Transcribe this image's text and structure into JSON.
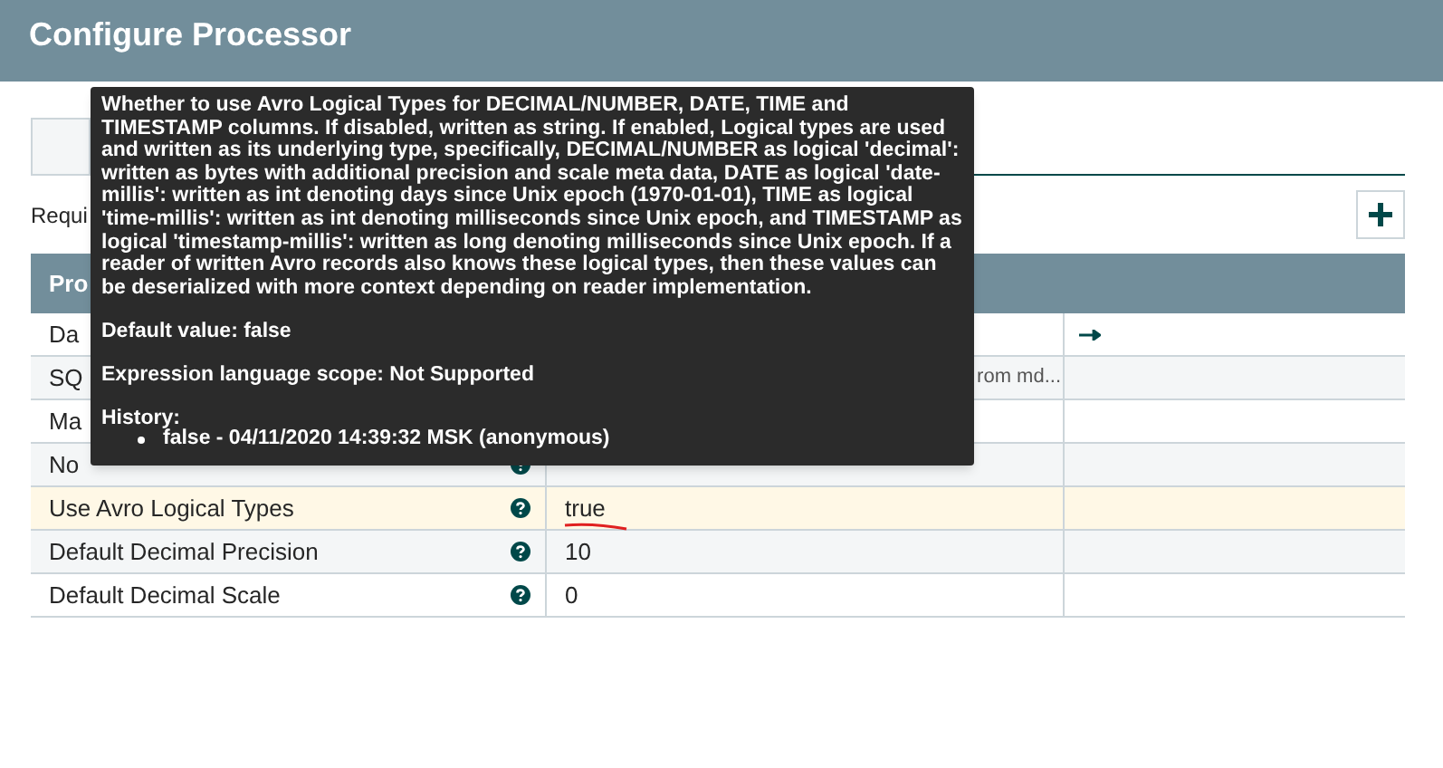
{
  "window": {
    "title": "Configure Processor"
  },
  "required_label": "Requi",
  "table": {
    "columns": [
      "Pro"
    ],
    "rows": [
      {
        "name": "Da",
        "kind": "service",
        "selected": false
      },
      {
        "name": "SQ",
        "value": "rom md...",
        "kind": "clipped",
        "selected": false
      },
      {
        "name": "Ma",
        "kind": "plain",
        "selected": false
      },
      {
        "name": "No",
        "kind": "plain",
        "selected": false
      },
      {
        "name": "Use Avro Logical Types",
        "value": "true",
        "kind": "plain",
        "selected": true
      },
      {
        "name": "Default Decimal Precision",
        "value": "10",
        "kind": "plain",
        "selected": false
      },
      {
        "name": "Default Decimal Scale",
        "value": "0",
        "kind": "plain",
        "selected": false
      }
    ]
  },
  "tooltip": {
    "description": "Whether to use Avro Logical Types for DECIMAL/NUMBER, DATE, TIME and TIMESTAMP columns. If disabled, written as string. If enabled, Logical types are used and written as its underlying type, specifically, DECIMAL/NUMBER as logical 'decimal': written as bytes with additional precision and scale meta data, DATE as logical 'date-millis': written as int denoting days since Unix epoch (1970-01-01), TIME as logical 'time-millis': written as int denoting milliseconds since Unix epoch, and TIMESTAMP as logical 'timestamp-millis': written as long denoting milliseconds since Unix epoch. If a reader of written Avro records also knows these logical types, then these values can be deserialized with more context depending on reader implementation.",
    "default_value": "Default value: false",
    "expression_scope": "Expression language scope: Not Supported",
    "history_label": "History:",
    "history": [
      "false - 04/11/2020 14:39:32 MSK (anonymous)"
    ]
  }
}
